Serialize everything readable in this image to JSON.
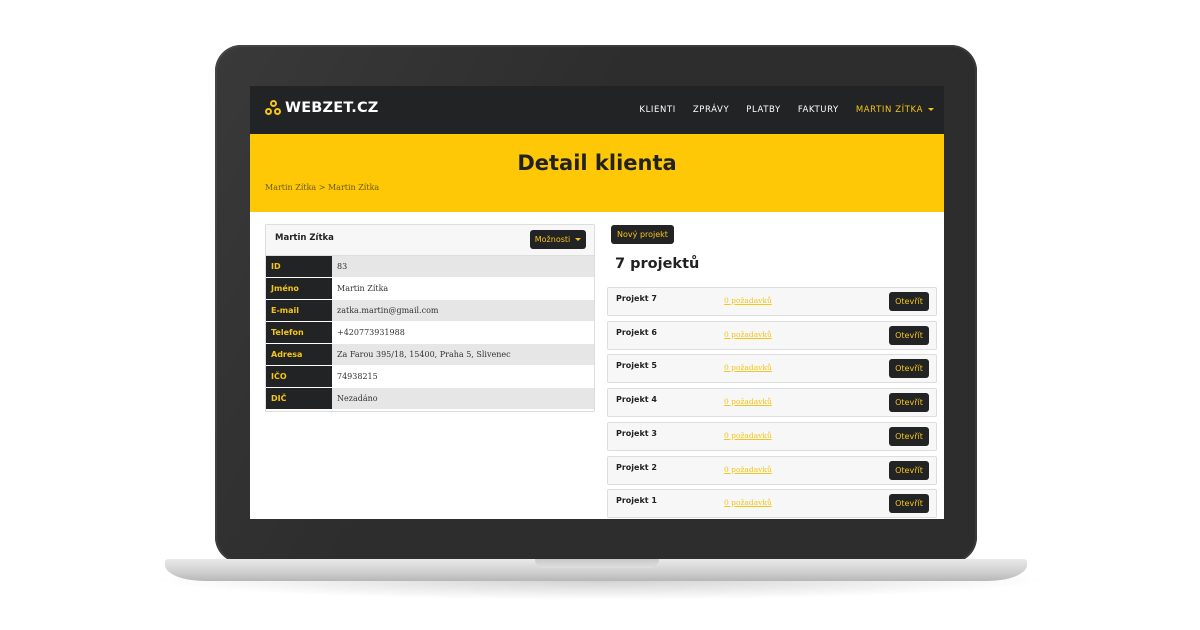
{
  "brand": {
    "name": "WEBZET.CZ",
    "accent": "#f5c518"
  },
  "nav": {
    "items": [
      "KLIENTI",
      "ZPRÁVY",
      "PLATBY",
      "FAKTURY"
    ],
    "user": "MARTIN ZÍTKA"
  },
  "hero": {
    "title": "Detail klienta",
    "breadcrumb": "Martin Zítka > Martin Zítka"
  },
  "client": {
    "name": "Martin Zítka",
    "options_label": "Možnosti",
    "fields": [
      {
        "label": "ID",
        "value": "83"
      },
      {
        "label": "Jméno",
        "value": "Martin Zítka"
      },
      {
        "label": "E-mail",
        "value": "zatka.martin@gmail.com"
      },
      {
        "label": "Telefon",
        "value": "+420773931988"
      },
      {
        "label": "Adresa",
        "value": "Za Farou 395/18, 15400, Praha 5, Slivenec"
      },
      {
        "label": "IČO",
        "value": "74938215"
      },
      {
        "label": "DIČ",
        "value": "Nezadáno"
      }
    ]
  },
  "projects": {
    "new_label": "Nový projekt",
    "count_label": "7 projektů",
    "items": [
      {
        "name": "Projekt 7",
        "requests": "0 požadavků",
        "open_label": "Otevřít"
      },
      {
        "name": "Projekt 6",
        "requests": "0 požadavků",
        "open_label": "Otevřít"
      },
      {
        "name": "Projekt 5",
        "requests": "0 požadavků",
        "open_label": "Otevřít"
      },
      {
        "name": "Projekt 4",
        "requests": "0 požadavků",
        "open_label": "Otevřít"
      },
      {
        "name": "Projekt 3",
        "requests": "0 požadavků",
        "open_label": "Otevřít"
      },
      {
        "name": "Projekt 2",
        "requests": "0 požadavků",
        "open_label": "Otevřít"
      },
      {
        "name": "Projekt 1",
        "requests": "0 požadavků",
        "open_label": "Otevřít"
      }
    ]
  }
}
